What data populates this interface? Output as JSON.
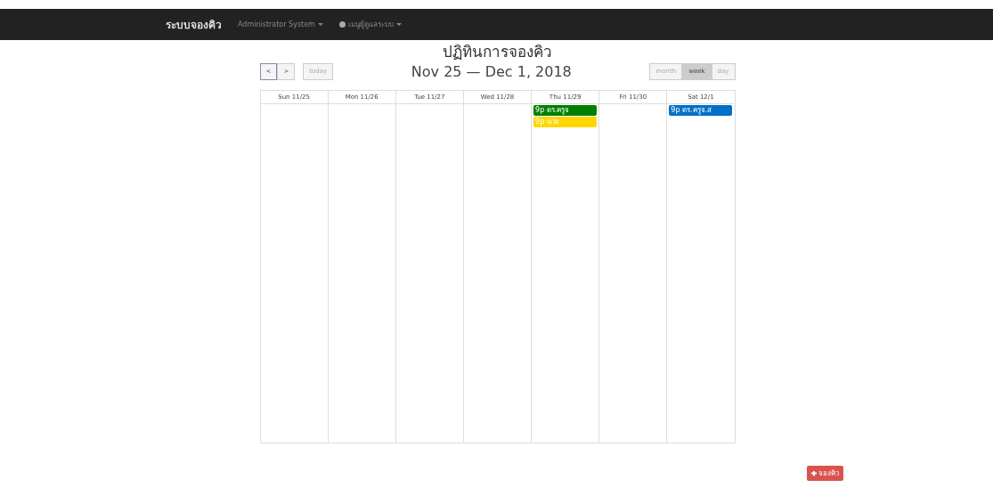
{
  "navbar": {
    "brand": "ระบบจองคิว",
    "menus": [
      {
        "label": "Administrator System",
        "icon": false
      },
      {
        "label": "เมนูผู้ดูแลระบบ",
        "icon": true
      }
    ]
  },
  "title": "ปฏิทินการจองคิว",
  "toolbar": {
    "prev": "<",
    "next": ">",
    "today": "today",
    "range": "Nov 25 — Dec 1, 2018",
    "views": [
      {
        "label": "month",
        "selected": false
      },
      {
        "label": "week",
        "selected": true
      },
      {
        "label": "day",
        "selected": false
      }
    ]
  },
  "calendar": {
    "days": [
      {
        "label": "Sun 11/25"
      },
      {
        "label": "Mon 11/26"
      },
      {
        "label": "Tue 11/27"
      },
      {
        "label": "Wed 11/28"
      },
      {
        "label": "Thu 11/29",
        "events": [
          {
            "time": "9p",
            "title": "ดร.ครูจ",
            "color": "#008000"
          },
          {
            "time": "9p",
            "title": "นาย",
            "color": "#ffd700"
          }
        ]
      },
      {
        "label": "Fri 11/30"
      },
      {
        "label": "Sat 12/1",
        "events": [
          {
            "time": "9p",
            "title": "ดร.ครูจ.ส",
            "color": "#0070c8"
          }
        ]
      }
    ]
  },
  "book_button": {
    "label": "จองคิว"
  }
}
